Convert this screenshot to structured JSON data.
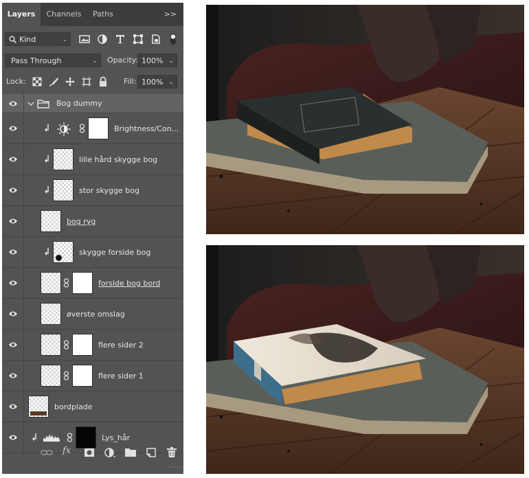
{
  "tabs": [
    {
      "label": "Layers",
      "active": true
    },
    {
      "label": "Channels",
      "active": false
    },
    {
      "label": "Paths",
      "active": false
    }
  ],
  "tab_menu": ">>",
  "filter": {
    "label": "Kind",
    "icons": [
      "search-icon",
      "image-filter-icon",
      "adjustment-filter-icon",
      "type-filter-icon",
      "shape-filter-icon",
      "smart-object-filter-icon",
      "filter-toggle-icon"
    ]
  },
  "blend": {
    "mode": "Pass Through",
    "opacity_label": "Opacity:",
    "opacity_value": "100%"
  },
  "lock": {
    "label": "Lock:",
    "fill_label": "Fill:",
    "fill_value": "100%",
    "icons": [
      "lock-transparent-icon",
      "lock-image-icon",
      "lock-position-icon",
      "lock-artboard-icon",
      "lock-all-icon"
    ]
  },
  "group": {
    "name": "Bog dummy"
  },
  "layers": [
    {
      "name": "Brightness/Con...",
      "kind": "adjustment",
      "clipped": true,
      "mask": true,
      "underline": false
    },
    {
      "name": "lille hård skygge bog",
      "kind": "pixel",
      "clipped": true,
      "mask": false,
      "underline": false
    },
    {
      "name": "stor skygge bog",
      "kind": "pixel",
      "clipped": true,
      "mask": false,
      "underline": false
    },
    {
      "name": "bog ryg",
      "kind": "pixel",
      "clipped": false,
      "mask": false,
      "underline": true
    },
    {
      "name": "skygge forside bog",
      "kind": "pixel",
      "clipped": true,
      "mask": false,
      "underline": false
    },
    {
      "name": "forside bog bord",
      "kind": "pixel",
      "clipped": false,
      "mask": true,
      "underline": true
    },
    {
      "name": "øverste omslag",
      "kind": "pixel",
      "clipped": false,
      "mask": false,
      "underline": false
    },
    {
      "name": "flere sider 2",
      "kind": "pixel",
      "clipped": false,
      "mask": true,
      "underline": false
    },
    {
      "name": "flere sider 1",
      "kind": "pixel",
      "clipped": false,
      "mask": true,
      "underline": false
    },
    {
      "name": "bordplade",
      "kind": "pixel",
      "clipped": false,
      "mask": false,
      "underline": false
    },
    {
      "name": "Lys_hår",
      "kind": "levels",
      "clipped": true,
      "mask": true,
      "underline": false
    }
  ],
  "bottom_icons": [
    "link-layers-icon",
    "fx-icon",
    "add-mask-icon",
    "new-adjustment-icon",
    "new-group-icon",
    "new-layer-icon",
    "delete-layer-icon"
  ],
  "fx_label": "fx",
  "colors": {
    "panel": "#535353",
    "tab_bar": "#3d3d3d",
    "group_row": "#636363",
    "wood": "#5a3a26",
    "book_dark": "#2a3030",
    "book_spine_blue": "#3d6f8d"
  }
}
